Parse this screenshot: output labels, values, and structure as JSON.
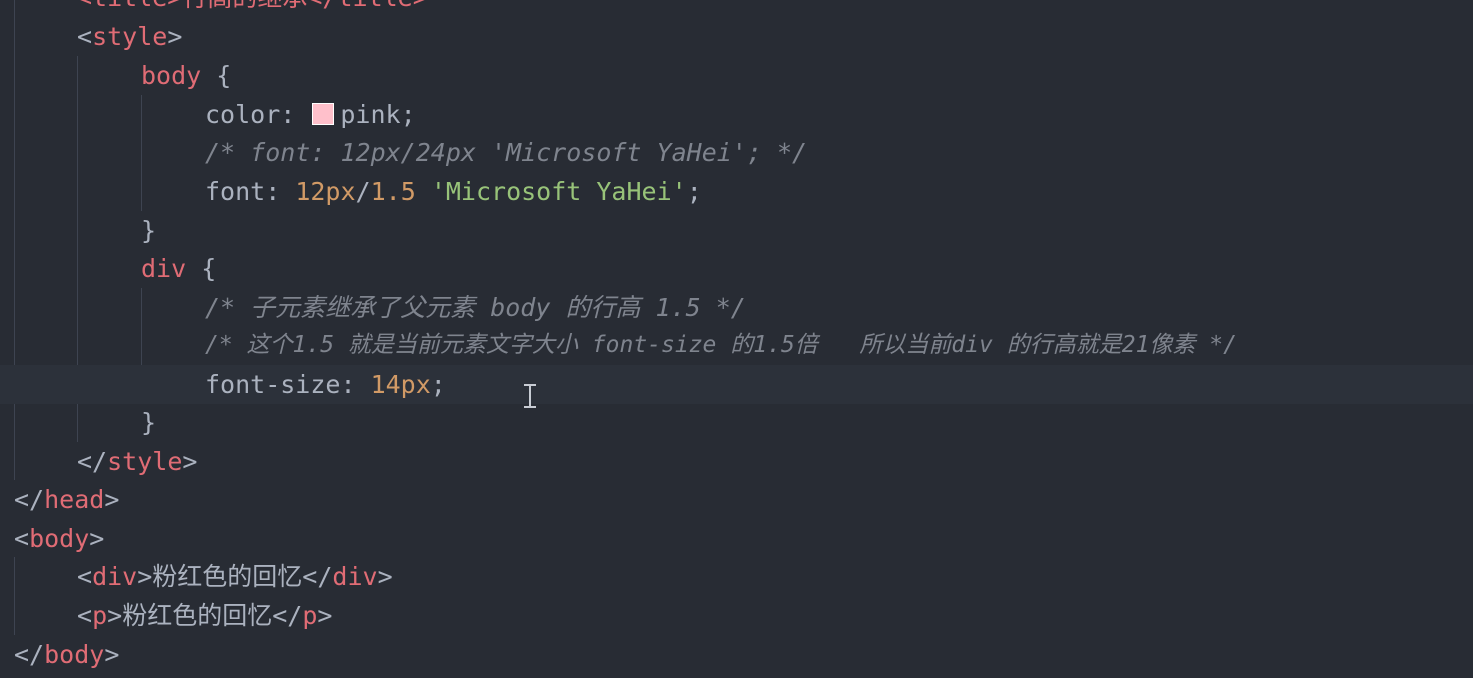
{
  "editor": {
    "lines": {
      "l0": {
        "text": "<title>行高的继承</title>"
      },
      "l1": {
        "open": "<",
        "tag": "style",
        "close": ">"
      },
      "l2": {
        "sel": "body",
        "brace": " {"
      },
      "l3": {
        "prop": "color: ",
        "value": "pink",
        "semi": ";"
      },
      "l4": {
        "comment": "/* font: 12px/24px 'Microsoft YaHei'; */"
      },
      "l5": {
        "prop": "font: ",
        "num1": "12px",
        "slash": "/",
        "num2": "1.5",
        "space": " ",
        "str": "'Microsoft YaHei'",
        "semi": ";"
      },
      "l6": {
        "brace": "}"
      },
      "l7": {
        "sel": "div",
        "brace": " {"
      },
      "l8": {
        "comment": "/* 子元素继承了父元素 body 的行高 1.5 */"
      },
      "l9": {
        "comment": "/* 这个1.5 就是当前元素文字大小 font-size 的1.5倍   所以当前div 的行高就是21像素 */"
      },
      "l10": {
        "prop": "font-size: ",
        "num": "14px",
        "semi": ";"
      },
      "l11": {
        "brace": "}"
      },
      "l12": {
        "open": "</",
        "tag": "style",
        "close": ">"
      },
      "l13": {
        "open": "</",
        "tag": "head",
        "close": ">"
      },
      "l14": {
        "open": "<",
        "tag": "body",
        "close": ">"
      },
      "l15": {
        "open": "<",
        "tag": "div",
        "close": ">",
        "content": "粉红色的回忆",
        "open2": "</",
        "tag2": "div",
        "close2": ">"
      },
      "l16": {
        "open": "<",
        "tag": "p",
        "close": ">",
        "content": "粉红色的回忆",
        "open2": "</",
        "tag2": "p",
        "close2": ">"
      },
      "l17": {
        "open": "</",
        "tag": "body",
        "close": ">"
      }
    },
    "colors": {
      "background": "#282c34",
      "tag": "#e06c75",
      "number": "#d19a66",
      "string": "#98c379",
      "comment": "#7f848e",
      "swatch_pink": "#ffc0cb"
    },
    "icons": [
      "color-swatch-icon",
      "text-cursor-icon"
    ]
  }
}
